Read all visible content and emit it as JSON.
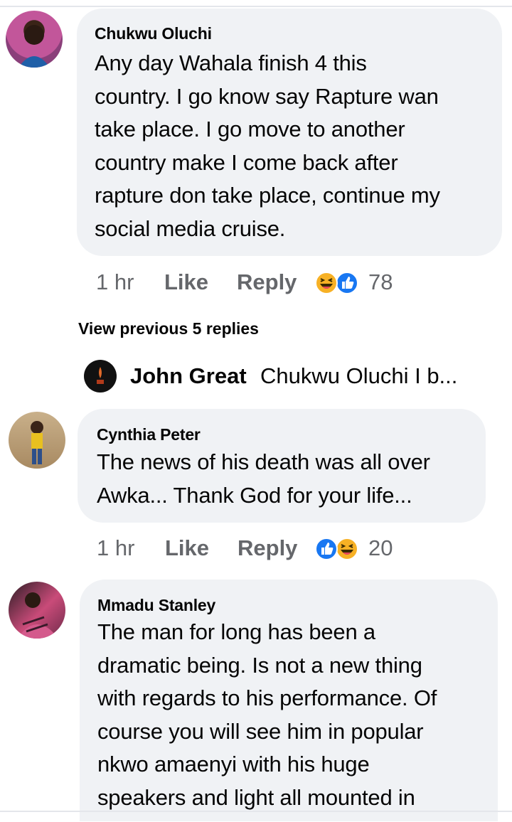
{
  "comments": [
    {
      "author": "Chukwu Oluchi",
      "lines": [
        "Any day Wahala finish 4 this",
        "country. I go know say Rapture wan",
        "take place. I go move to another",
        "country make I come back after",
        "rapture don take place, continue my",
        "social media cruise."
      ],
      "time": "1 hr",
      "like_label": "Like",
      "reply_label": "Reply",
      "reactions": [
        "haha-icon",
        "like-icon"
      ],
      "reaction_count": "78"
    },
    {
      "author": "Cynthia Peter",
      "lines": [
        "The news of his death was all over",
        "Awka... Thank God for your life..."
      ],
      "time": "1 hr",
      "like_label": "Like",
      "reply_label": "Reply",
      "reactions": [
        "like-icon",
        "haha-icon"
      ],
      "reaction_count": "20"
    },
    {
      "author": "Mmadu Stanley",
      "lines": [
        "The man for long has been a",
        "dramatic being. Is not a new thing",
        "with regards to his performance. Of",
        "course you will see him in popular",
        "nkwo amaenyi with his huge",
        "speakers and light all mounted in"
      ]
    }
  ],
  "view_previous": "View previous 5 replies",
  "reply_preview": {
    "author": "John Great",
    "snippet": "Chukwu Oluchi I b..."
  },
  "colors": {
    "bubble": "#f0f2f5",
    "meta_text": "#65676b",
    "like_blue": "#1877f2",
    "haha_yellow": "#f7b125"
  }
}
